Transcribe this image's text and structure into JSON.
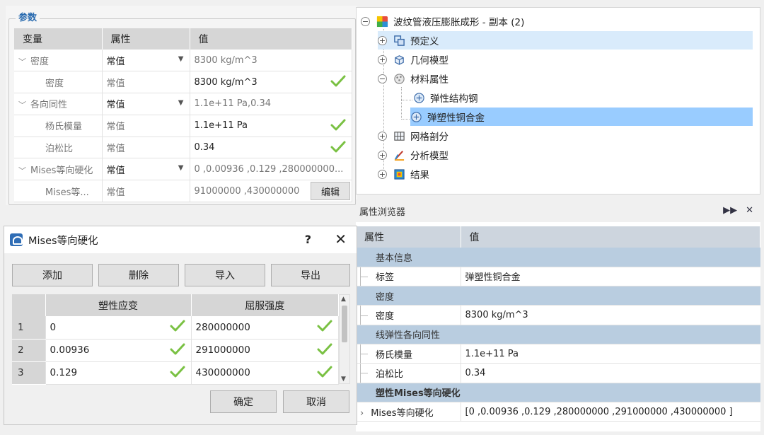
{
  "params": {
    "group_title": "参数",
    "headers": [
      "变量",
      "属性",
      "值"
    ],
    "rows": [
      {
        "name": "密度",
        "prop": "常值",
        "value": "8300 kg/m^3",
        "level": 0,
        "expandable": true
      },
      {
        "name": "密度",
        "prop": "常值",
        "value": "8300 kg/m^3",
        "level": 1,
        "check": true
      },
      {
        "name": "各向同性",
        "prop": "常值",
        "value": "1.1e+11 Pa,0.34",
        "level": 0,
        "expandable": true
      },
      {
        "name": "杨氏模量",
        "prop": "常值",
        "value": "1.1e+11 Pa",
        "level": 1,
        "check": true
      },
      {
        "name": "泊松比",
        "prop": "常值",
        "value": "0.34",
        "level": 1,
        "check": true
      },
      {
        "name": "Mises等向硬化",
        "prop": "常值",
        "value": "0 ,0.00936 ,0.129 ,280000000...",
        "level": 0,
        "expandable": true
      },
      {
        "name": "Mises等...",
        "prop": "常值",
        "value": "91000000 ,430000000",
        "level": 1,
        "button": "编辑"
      }
    ]
  },
  "tree": {
    "root": "波纹管液压膨胀成形 - 副本 (2)",
    "items": [
      {
        "label": "预定义",
        "expander": "+",
        "icon": "predefined-icon"
      },
      {
        "label": "几何模型",
        "expander": "+",
        "icon": "geometry-icon"
      },
      {
        "label": "材料属性",
        "expander": "−",
        "icon": "material-icon"
      },
      {
        "label": "弹性结构钢",
        "icon": "material-item-icon"
      },
      {
        "label": "弹塑性铜合金",
        "icon": "material-item-icon"
      },
      {
        "label": "网格剖分",
        "expander": "+",
        "icon": "mesh-icon"
      },
      {
        "label": "分析模型",
        "expander": "+",
        "icon": "analysis-icon"
      },
      {
        "label": "结果",
        "expander": "+",
        "icon": "result-icon"
      }
    ]
  },
  "property_browser": {
    "title": "属性浏览器",
    "headers": [
      "属性",
      "值"
    ],
    "rows": [
      {
        "section": "基本信息"
      },
      {
        "key": "标签",
        "value": "弹塑性铜合金"
      },
      {
        "section": "密度"
      },
      {
        "key": "密度",
        "value": "8300 kg/m^3"
      },
      {
        "section": "线弹性各向同性"
      },
      {
        "key": "杨氏模量",
        "value": "1.1e+11 Pa"
      },
      {
        "key": "泊松比",
        "value": "0.34"
      },
      {
        "section": "塑性Mises等向硬化",
        "bold": true
      },
      {
        "key": "Mises等向硬化",
        "value": "[0 ,0.00936 ,0.129 ,280000000 ,291000000 ,430000000 ]",
        "expandable": true
      }
    ]
  },
  "dialog": {
    "title": "Mises等向硬化",
    "help": "?",
    "close": "✕",
    "buttons": [
      "添加",
      "删除",
      "导入",
      "导出"
    ],
    "headers": [
      "塑性应变",
      "屈服强度"
    ],
    "rows": [
      {
        "n": "1",
        "strain": "0",
        "stress": "280000000"
      },
      {
        "n": "2",
        "strain": "0.00936",
        "stress": "291000000"
      },
      {
        "n": "3",
        "strain": "0.129",
        "stress": "430000000"
      }
    ],
    "ok": "确定",
    "cancel": "取消"
  },
  "colors": {
    "selection": "#99ccff",
    "hover": "#d9ebfb",
    "section": "#b9cde0",
    "check": "#7ac143",
    "title": "#2b6cb0"
  }
}
